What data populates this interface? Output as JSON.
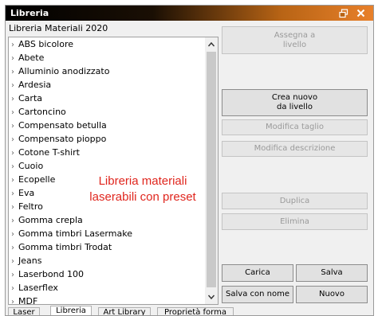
{
  "window": {
    "title": "Libreria"
  },
  "library": {
    "title": "Libreria Materiali 2020",
    "items": [
      "ABS bicolore",
      "Abete",
      "Alluminio anodizzato",
      "Ardesia",
      "Carta",
      "Cartoncino",
      "Compensato betulla",
      "Compensato pioppo",
      "Cotone T-shirt",
      "Cuoio",
      "Ecopelle",
      "Eva",
      "Feltro",
      "Gomma crepla",
      "Gomma timbri Lasermake",
      "Gomma timbri Trodat",
      "Jeans",
      "Laserbond 100",
      "Laserflex",
      "MDF"
    ]
  },
  "overlay": {
    "line1": "Libreria materiali",
    "line2": "laserabili con preset"
  },
  "buttons": {
    "assign_line1": "Assegna a",
    "assign_line2": "livello",
    "create_line1": "Crea nuovo",
    "create_line2": "da livello",
    "edit_cut": "Modifica taglio",
    "edit_desc": "Modifica descrizione",
    "duplicate": "Duplica",
    "delete": "Elimina",
    "load": "Carica",
    "save": "Salva",
    "save_as": "Salva con nome",
    "new": "Nuovo"
  },
  "tabs": [
    "Laser",
    "Libreria",
    "Art Library",
    "Proprietà forma"
  ],
  "active_tab": 1
}
